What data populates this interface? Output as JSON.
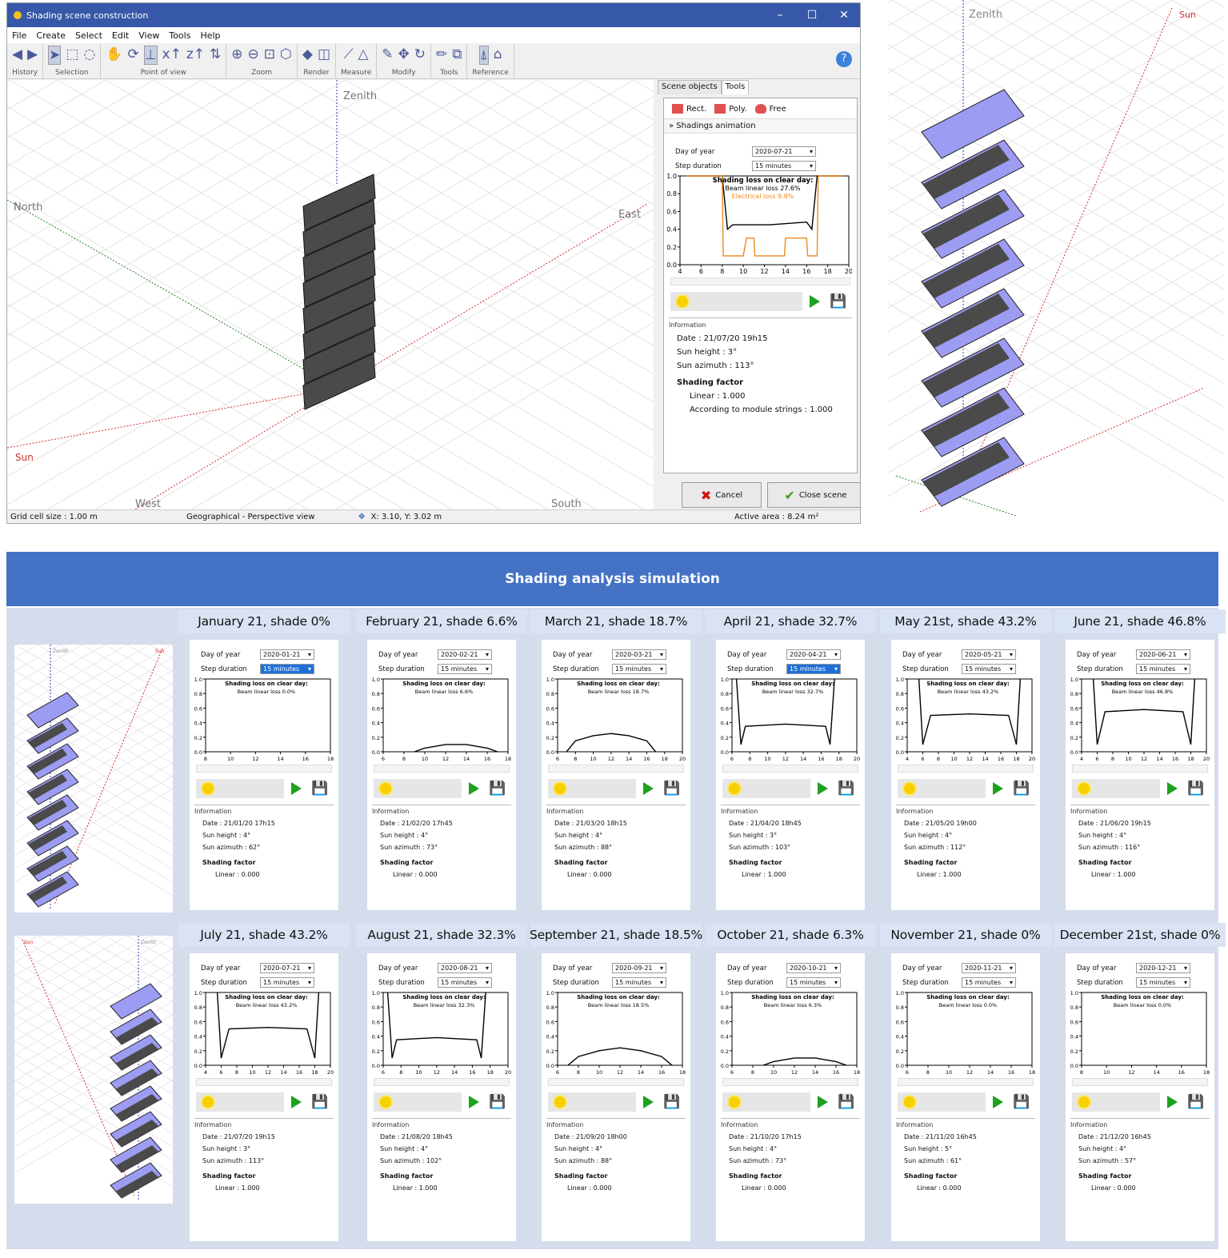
{
  "window": {
    "title": "Shading scene construction",
    "minimize": "–",
    "maximize": "☐",
    "close": "✕"
  },
  "menu": [
    "File",
    "Create",
    "Select",
    "Edit",
    "View",
    "Tools",
    "Help"
  ],
  "toolbar_groups": [
    {
      "label": "History",
      "icons": [
        "◀",
        "▶"
      ]
    },
    {
      "label": "Selection",
      "icons": [
        "➤",
        "⬚",
        "◌"
      ]
    },
    {
      "label": "Point of view",
      "icons": [
        "✋",
        "⟳",
        "⊥",
        "x↑",
        "z↑",
        "⇅"
      ]
    },
    {
      "label": "Zoom",
      "icons": [
        "⊕",
        "⊖",
        "⊡",
        "⬡"
      ]
    },
    {
      "label": "Render",
      "icons": [
        "◆",
        "◫"
      ]
    },
    {
      "label": "Measure",
      "icons": [
        "⟋",
        "△"
      ]
    },
    {
      "label": "Modify",
      "icons": [
        "✎",
        "✥",
        "↻"
      ]
    },
    {
      "label": "Tools",
      "icons": [
        "✏",
        "⧉"
      ]
    },
    {
      "label": "Reference",
      "icons": [
        "⍋",
        "⌂"
      ]
    }
  ],
  "help": "?",
  "viewport": {
    "zenith": "Zenith",
    "north": "North",
    "east": "East",
    "sun": "Sun",
    "west": "West",
    "south": "South"
  },
  "panel": {
    "tabs": [
      "Scene objects",
      "Tools"
    ],
    "draw": [
      "Rect.",
      "Poly.",
      "Free"
    ],
    "anim_header": "Shadings animation",
    "day_label": "Day of year",
    "day_value": "2020-07-21",
    "step_label": "Step duration",
    "step_value": "15 minutes",
    "chart_title": "Shading loss on clear day:",
    "beam": "Beam linear loss 27.6%",
    "elec": "Electrical loss 9.8%",
    "info_title": "Information",
    "date": "Date : 21/07/20 19h15",
    "height": "Sun height : 3°",
    "azimuth": "Sun azimuth : 113°",
    "sf": "Shading factor",
    "linear": "Linear : 1.000",
    "module": "According to module strings : 1.000",
    "cancel": "Cancel",
    "close": "Close scene"
  },
  "status": {
    "grid": "Grid cell size : 1.00 m",
    "view": "Geographical - Perspective view",
    "coords": "X: 3.10, Y: 3.02 m",
    "area": "Active area : 8.24 m²"
  },
  "right_view": {
    "zenith": "Zenith",
    "sun": "Sun"
  },
  "banner": "Shading analysis simulation",
  "colors": {
    "accent": "#4472c4",
    "header_bg": "#dae3f3",
    "module": "#555555",
    "frame": "#9a9af0",
    "beam_curve": "#000000",
    "elec_curve": "#ee8a20"
  },
  "chart_data": {
    "type": "line",
    "title": "Shading loss on clear day:",
    "xlabel": "",
    "ylabel": "",
    "ylim": [
      0,
      1
    ],
    "yticks": [
      "0.0",
      "0.2",
      "0.4",
      "0.6",
      "0.8",
      "1.0"
    ],
    "panels": [
      {
        "month": "July 21 (main dialog)",
        "xticks": [
          "4",
          "6",
          "8",
          "10",
          "12",
          "14",
          "16",
          "18",
          "20"
        ],
        "series": [
          {
            "name": "Beam linear loss 27.6%",
            "x": [
              4.5,
              8,
              8.5,
              9,
              12.5,
              16,
              16.5,
              17,
              19.5
            ],
            "y": [
              1,
              1,
              0.4,
              0.45,
              0.45,
              0.48,
              0.4,
              1,
              1
            ]
          },
          {
            "name": "Electrical loss 9.8%",
            "x": [
              4.5,
              8,
              8.1,
              10,
              10.3,
              11,
              11.1,
              13.9,
              14,
              16,
              16.1,
              17,
              17.1,
              19.5
            ],
            "y": [
              1,
              1,
              0.1,
              0.1,
              0.3,
              0.3,
              0.1,
              0.1,
              0.3,
              0.3,
              0.1,
              0.1,
              1,
              1
            ]
          }
        ]
      }
    ]
  },
  "months": [
    {
      "header": "January 21, shade 0%",
      "day": "2020-01-21",
      "step": "15 minutes",
      "beam": "Beam linear loss 0.0%",
      "xticks": [
        "8",
        "10",
        "12",
        "14",
        "16",
        "18"
      ],
      "curve": {
        "x": [],
        "y": []
      },
      "date": "Date : 21/01/20 17h15",
      "height": "Sun height : 4°",
      "azimuth": "Sun azimuth : 62°",
      "linear": "Linear : 0.000"
    },
    {
      "header": "February 21, shade 6.6%",
      "day": "2020-02-21",
      "step": "15 minutes",
      "beam": "Beam linear loss 6.6%",
      "xticks": [
        "6",
        "8",
        "10",
        "12",
        "14",
        "16",
        "18"
      ],
      "curve": {
        "x": [
          9,
          10,
          12,
          14,
          16,
          17
        ],
        "y": [
          0,
          0.05,
          0.1,
          0.1,
          0.05,
          0
        ]
      },
      "date": "Date : 21/02/20 17h45",
      "height": "Sun height : 4°",
      "azimuth": "Sun azimuth : 73°",
      "linear": "Linear : 0.000"
    },
    {
      "header": "March 21, shade 18.7%",
      "day": "2020-03-21",
      "step": "15 minutes",
      "beam": "Beam linear loss 18.7%",
      "xticks": [
        "6",
        "8",
        "10",
        "12",
        "14",
        "16",
        "18",
        "20"
      ],
      "curve": {
        "x": [
          7,
          8,
          10,
          12,
          14,
          16,
          17
        ],
        "y": [
          0,
          0.15,
          0.22,
          0.25,
          0.22,
          0.15,
          0
        ]
      },
      "date": "Date : 21/03/20 18h15",
      "height": "Sun height : 4°",
      "azimuth": "Sun azimuth : 88°",
      "linear": "Linear : 0.000"
    },
    {
      "header": "April 21, shade 32.7%",
      "day": "2020-04-21",
      "step": "15 minutes",
      "beam": "Beam linear loss 32.7%",
      "xticks": [
        "6",
        "8",
        "10",
        "12",
        "14",
        "16",
        "18",
        "20"
      ],
      "curve": {
        "x": [
          6.5,
          7,
          7.5,
          12,
          16.5,
          17,
          17.5
        ],
        "y": [
          1,
          0.1,
          0.35,
          0.38,
          0.35,
          0.1,
          1
        ]
      },
      "date": "Date : 21/04/20 18h45",
      "height": "Sun height : 3°",
      "azimuth": "Sun azimuth : 103°",
      "linear": "Linear : 1.000"
    },
    {
      "header": "May 21st, shade 43.2%",
      "day": "2020-05-21",
      "step": "15 minutes",
      "beam": "Beam linear loss 43.2%",
      "xticks": [
        "4",
        "6",
        "8",
        "10",
        "12",
        "14",
        "16",
        "18",
        "20"
      ],
      "curve": {
        "x": [
          5.5,
          6,
          7,
          12,
          17,
          18,
          18.5
        ],
        "y": [
          1,
          0.1,
          0.5,
          0.52,
          0.5,
          0.1,
          1
        ]
      },
      "date": "Date : 21/05/20 19h00",
      "height": "Sun height : 4°",
      "azimuth": "Sun azimuth : 112°",
      "linear": "Linear : 1.000"
    },
    {
      "header": "June 21, shade 46.8%",
      "day": "2020-06-21",
      "step": "15 minutes",
      "beam": "Beam linear loss 46.8%",
      "xticks": [
        "4",
        "6",
        "8",
        "10",
        "12",
        "14",
        "16",
        "18",
        "20"
      ],
      "curve": {
        "x": [
          5.5,
          6,
          7,
          12,
          17,
          18,
          18.5
        ],
        "y": [
          1,
          0.1,
          0.55,
          0.58,
          0.55,
          0.1,
          1
        ]
      },
      "date": "Date : 21/06/20 19h15",
      "height": "Sun height : 4°",
      "azimuth": "Sun azimuth : 116°",
      "linear": "Linear : 1.000"
    },
    {
      "header": "July 21, shade 43.2%",
      "day": "2020-07-21",
      "step": "15 minutes",
      "beam": "Beam linear loss 43.2%",
      "xticks": [
        "4",
        "6",
        "8",
        "10",
        "12",
        "14",
        "16",
        "18",
        "20"
      ],
      "curve": {
        "x": [
          5.5,
          6,
          7,
          12,
          17,
          18,
          18.5
        ],
        "y": [
          1,
          0.1,
          0.5,
          0.52,
          0.5,
          0.1,
          1
        ]
      },
      "date": "Date : 21/07/20 19h15",
      "height": "Sun height : 3°",
      "azimuth": "Sun azimuth : 113°",
      "linear": "Linear : 1.000"
    },
    {
      "header": "August 21, shade 32.3%",
      "day": "2020-08-21",
      "step": "15 minutes",
      "beam": "Beam linear loss 32.3%",
      "xticks": [
        "6",
        "8",
        "10",
        "12",
        "14",
        "16",
        "18",
        "20"
      ],
      "curve": {
        "x": [
          6.5,
          7,
          7.5,
          12,
          16.5,
          17,
          17.5
        ],
        "y": [
          1,
          0.1,
          0.35,
          0.38,
          0.35,
          0.1,
          1
        ]
      },
      "date": "Date : 21/08/20 18h45",
      "height": "Sun height : 4°",
      "azimuth": "Sun azimuth : 102°",
      "linear": "Linear : 1.000"
    },
    {
      "header": "September 21, shade 18.5%",
      "day": "2020-09-21",
      "step": "15 minutes",
      "beam": "Beam linear loss 18.5%",
      "xticks": [
        "6",
        "8",
        "10",
        "12",
        "14",
        "16",
        "18"
      ],
      "curve": {
        "x": [
          7,
          8,
          10,
          12,
          14,
          16,
          17
        ],
        "y": [
          0,
          0.12,
          0.2,
          0.24,
          0.2,
          0.12,
          0
        ]
      },
      "date": "Date : 21/09/20 18h00",
      "height": "Sun height : 4°",
      "azimuth": "Sun azimuth : 88°",
      "linear": "Linear : 0.000"
    },
    {
      "header": "October 21, shade 6.3%",
      "day": "2020-10-21",
      "step": "15 minutes",
      "beam": "Beam linear loss 6.3%",
      "xticks": [
        "6",
        "8",
        "10",
        "12",
        "14",
        "16",
        "18"
      ],
      "curve": {
        "x": [
          9,
          10,
          12,
          14,
          16,
          17
        ],
        "y": [
          0,
          0.05,
          0.1,
          0.1,
          0.05,
          0
        ]
      },
      "date": "Date : 21/10/20 17h15",
      "height": "Sun height : 4°",
      "azimuth": "Sun azimuth : 73°",
      "linear": "Linear : 0.000"
    },
    {
      "header": "November 21, shade 0%",
      "day": "2020-11-21",
      "step": "15 minutes",
      "beam": "Beam linear loss 0.0%",
      "xticks": [
        "6",
        "8",
        "10",
        "12",
        "14",
        "16",
        "18"
      ],
      "curve": {
        "x": [],
        "y": []
      },
      "date": "Date : 21/11/20 16h45",
      "height": "Sun height : 5°",
      "azimuth": "Sun azimuth : 61°",
      "linear": "Linear : 0.000"
    },
    {
      "header": "December 21st, shade 0%",
      "day": "2020-12-21",
      "step": "15 minutes",
      "beam": "Beam linear loss 0.0%",
      "xticks": [
        "8",
        "10",
        "12",
        "14",
        "16",
        "18"
      ],
      "curve": {
        "x": [],
        "y": []
      },
      "date": "Date : 21/12/20 16h45",
      "height": "Sun height : 4°",
      "azimuth": "Sun azimuth : 57°",
      "linear": "Linear : 0.000"
    }
  ],
  "card_labels": {
    "day": "Day of year",
    "step": "Step duration",
    "chart_title": "Shading loss on clear day:",
    "info": "Information",
    "sf": "Shading factor"
  },
  "thumb_labels": {
    "zenith": "Zenith",
    "sun": "Sun"
  }
}
